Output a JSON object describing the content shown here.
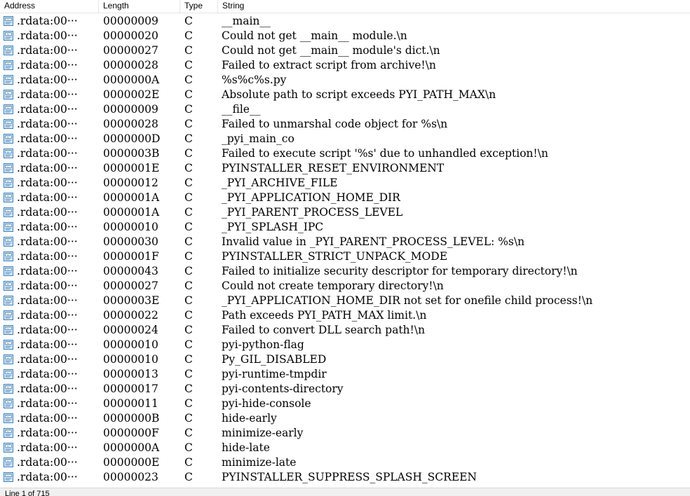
{
  "columns": {
    "address": "Address",
    "length": "Length",
    "type": "Type",
    "string": "String"
  },
  "row_icon": "string-literal-icon",
  "rows": [
    {
      "address": ".rdata:00···",
      "length": "00000009",
      "type": "C",
      "string": "__main__"
    },
    {
      "address": ".rdata:00···",
      "length": "00000020",
      "type": "C",
      "string": "Could not get __main__ module.\\n"
    },
    {
      "address": ".rdata:00···",
      "length": "00000027",
      "type": "C",
      "string": "Could not get __main__ module's dict.\\n"
    },
    {
      "address": ".rdata:00···",
      "length": "00000028",
      "type": "C",
      "string": "Failed to extract script from archive!\\n"
    },
    {
      "address": ".rdata:00···",
      "length": "0000000A",
      "type": "C",
      "string": "%s%c%s.py"
    },
    {
      "address": ".rdata:00···",
      "length": "0000002E",
      "type": "C",
      "string": "Absolute path to script exceeds PYI_PATH_MAX\\n"
    },
    {
      "address": ".rdata:00···",
      "length": "00000009",
      "type": "C",
      "string": "__file__"
    },
    {
      "address": ".rdata:00···",
      "length": "00000028",
      "type": "C",
      "string": "Failed to unmarshal code object for %s\\n"
    },
    {
      "address": ".rdata:00···",
      "length": "0000000D",
      "type": "C",
      "string": "_pyi_main_co"
    },
    {
      "address": ".rdata:00···",
      "length": "0000003B",
      "type": "C",
      "string": "Failed to execute script '%s' due to unhandled exception!\\n"
    },
    {
      "address": ".rdata:00···",
      "length": "0000001E",
      "type": "C",
      "string": "PYINSTALLER_RESET_ENVIRONMENT"
    },
    {
      "address": ".rdata:00···",
      "length": "00000012",
      "type": "C",
      "string": "_PYI_ARCHIVE_FILE"
    },
    {
      "address": ".rdata:00···",
      "length": "0000001A",
      "type": "C",
      "string": "_PYI_APPLICATION_HOME_DIR"
    },
    {
      "address": ".rdata:00···",
      "length": "0000001A",
      "type": "C",
      "string": "_PYI_PARENT_PROCESS_LEVEL"
    },
    {
      "address": ".rdata:00···",
      "length": "00000010",
      "type": "C",
      "string": "_PYI_SPLASH_IPC"
    },
    {
      "address": ".rdata:00···",
      "length": "00000030",
      "type": "C",
      "string": "Invalid value in _PYI_PARENT_PROCESS_LEVEL: %s\\n"
    },
    {
      "address": ".rdata:00···",
      "length": "0000001F",
      "type": "C",
      "string": "PYINSTALLER_STRICT_UNPACK_MODE"
    },
    {
      "address": ".rdata:00···",
      "length": "00000043",
      "type": "C",
      "string": "Failed to initialize security descriptor for temporary directory!\\n"
    },
    {
      "address": ".rdata:00···",
      "length": "00000027",
      "type": "C",
      "string": "Could not create temporary directory!\\n"
    },
    {
      "address": ".rdata:00···",
      "length": "0000003E",
      "type": "C",
      "string": "_PYI_APPLICATION_HOME_DIR not set for onefile child process!\\n"
    },
    {
      "address": ".rdata:00···",
      "length": "00000022",
      "type": "C",
      "string": "Path exceeds PYI_PATH_MAX limit.\\n"
    },
    {
      "address": ".rdata:00···",
      "length": "00000024",
      "type": "C",
      "string": "Failed to convert DLL search path!\\n"
    },
    {
      "address": ".rdata:00···",
      "length": "00000010",
      "type": "C",
      "string": "pyi-python-flag"
    },
    {
      "address": ".rdata:00···",
      "length": "00000010",
      "type": "C",
      "string": "Py_GIL_DISABLED"
    },
    {
      "address": ".rdata:00···",
      "length": "00000013",
      "type": "C",
      "string": "pyi-runtime-tmpdir"
    },
    {
      "address": ".rdata:00···",
      "length": "00000017",
      "type": "C",
      "string": "pyi-contents-directory"
    },
    {
      "address": ".rdata:00···",
      "length": "00000011",
      "type": "C",
      "string": "pyi-hide-console"
    },
    {
      "address": ".rdata:00···",
      "length": "0000000B",
      "type": "C",
      "string": "hide-early"
    },
    {
      "address": ".rdata:00···",
      "length": "0000000F",
      "type": "C",
      "string": "minimize-early"
    },
    {
      "address": ".rdata:00···",
      "length": "0000000A",
      "type": "C",
      "string": "hide-late"
    },
    {
      "address": ".rdata:00···",
      "length": "0000000E",
      "type": "C",
      "string": "minimize-late"
    },
    {
      "address": ".rdata:00···",
      "length": "00000023",
      "type": "C",
      "string": "PYINSTALLER_SUPPRESS_SPLASH_SCREEN"
    }
  ],
  "status": {
    "text": "Line 1 of 715"
  },
  "colors": {
    "icon_border": "#3a7fc0",
    "icon_fill": "#dbe9f7",
    "icon_accent": "#2e8b57"
  }
}
